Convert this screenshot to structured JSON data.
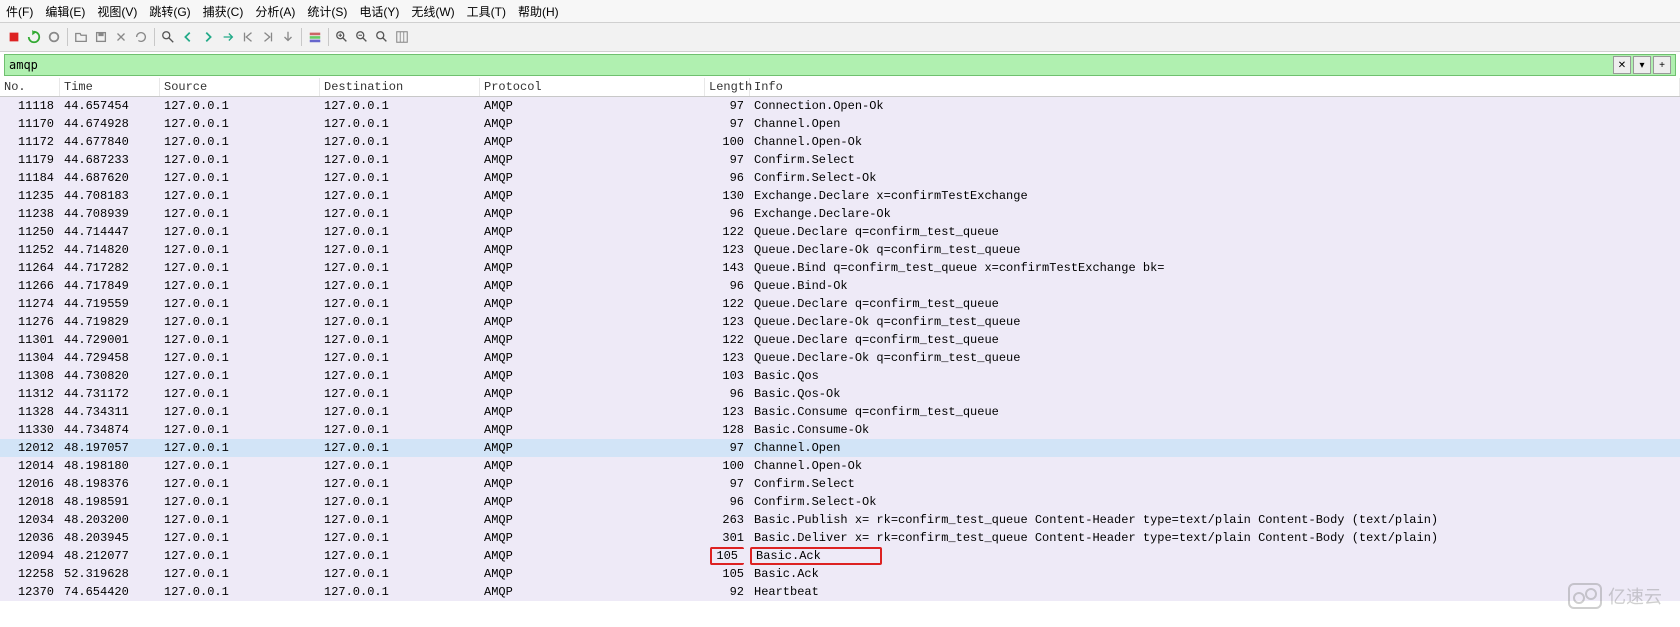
{
  "menu": {
    "items": [
      "件(F)",
      "编辑(E)",
      "视图(V)",
      "跳转(G)",
      "捕获(C)",
      "分析(A)",
      "统计(S)",
      "电话(Y)",
      "无线(W)",
      "工具(T)",
      "帮助(H)"
    ]
  },
  "filter": {
    "text": "amqp",
    "buttons": [
      "✕",
      "▾",
      "+"
    ]
  },
  "columns": [
    "No.",
    "Time",
    "Source",
    "Destination",
    "Protocol",
    "Length",
    "Info"
  ],
  "packets": [
    {
      "no": "11118",
      "time": "44.657454",
      "src": "127.0.0.1",
      "dst": "127.0.0.1",
      "proto": "AMQP",
      "len": "97",
      "info": "Connection.Open-Ok"
    },
    {
      "no": "11170",
      "time": "44.674928",
      "src": "127.0.0.1",
      "dst": "127.0.0.1",
      "proto": "AMQP",
      "len": "97",
      "info": "Channel.Open"
    },
    {
      "no": "11172",
      "time": "44.677840",
      "src": "127.0.0.1",
      "dst": "127.0.0.1",
      "proto": "AMQP",
      "len": "100",
      "info": "Channel.Open-Ok"
    },
    {
      "no": "11179",
      "time": "44.687233",
      "src": "127.0.0.1",
      "dst": "127.0.0.1",
      "proto": "AMQP",
      "len": "97",
      "info": "Confirm.Select"
    },
    {
      "no": "11184",
      "time": "44.687620",
      "src": "127.0.0.1",
      "dst": "127.0.0.1",
      "proto": "AMQP",
      "len": "96",
      "info": "Confirm.Select-Ok"
    },
    {
      "no": "11235",
      "time": "44.708183",
      "src": "127.0.0.1",
      "dst": "127.0.0.1",
      "proto": "AMQP",
      "len": "130",
      "info": "Exchange.Declare x=confirmTestExchange"
    },
    {
      "no": "11238",
      "time": "44.708939",
      "src": "127.0.0.1",
      "dst": "127.0.0.1",
      "proto": "AMQP",
      "len": "96",
      "info": "Exchange.Declare-Ok"
    },
    {
      "no": "11250",
      "time": "44.714447",
      "src": "127.0.0.1",
      "dst": "127.0.0.1",
      "proto": "AMQP",
      "len": "122",
      "info": "Queue.Declare q=confirm_test_queue"
    },
    {
      "no": "11252",
      "time": "44.714820",
      "src": "127.0.0.1",
      "dst": "127.0.0.1",
      "proto": "AMQP",
      "len": "123",
      "info": "Queue.Declare-Ok q=confirm_test_queue"
    },
    {
      "no": "11264",
      "time": "44.717282",
      "src": "127.0.0.1",
      "dst": "127.0.0.1",
      "proto": "AMQP",
      "len": "143",
      "info": "Queue.Bind q=confirm_test_queue x=confirmTestExchange bk="
    },
    {
      "no": "11266",
      "time": "44.717849",
      "src": "127.0.0.1",
      "dst": "127.0.0.1",
      "proto": "AMQP",
      "len": "96",
      "info": "Queue.Bind-Ok"
    },
    {
      "no": "11274",
      "time": "44.719559",
      "src": "127.0.0.1",
      "dst": "127.0.0.1",
      "proto": "AMQP",
      "len": "122",
      "info": "Queue.Declare q=confirm_test_queue"
    },
    {
      "no": "11276",
      "time": "44.719829",
      "src": "127.0.0.1",
      "dst": "127.0.0.1",
      "proto": "AMQP",
      "len": "123",
      "info": "Queue.Declare-Ok q=confirm_test_queue"
    },
    {
      "no": "11301",
      "time": "44.729001",
      "src": "127.0.0.1",
      "dst": "127.0.0.1",
      "proto": "AMQP",
      "len": "122",
      "info": "Queue.Declare q=confirm_test_queue"
    },
    {
      "no": "11304",
      "time": "44.729458",
      "src": "127.0.0.1",
      "dst": "127.0.0.1",
      "proto": "AMQP",
      "len": "123",
      "info": "Queue.Declare-Ok q=confirm_test_queue"
    },
    {
      "no": "11308",
      "time": "44.730820",
      "src": "127.0.0.1",
      "dst": "127.0.0.1",
      "proto": "AMQP",
      "len": "103",
      "info": "Basic.Qos"
    },
    {
      "no": "11312",
      "time": "44.731172",
      "src": "127.0.0.1",
      "dst": "127.0.0.1",
      "proto": "AMQP",
      "len": "96",
      "info": "Basic.Qos-Ok"
    },
    {
      "no": "11328",
      "time": "44.734311",
      "src": "127.0.0.1",
      "dst": "127.0.0.1",
      "proto": "AMQP",
      "len": "123",
      "info": "Basic.Consume q=confirm_test_queue"
    },
    {
      "no": "11330",
      "time": "44.734874",
      "src": "127.0.0.1",
      "dst": "127.0.0.1",
      "proto": "AMQP",
      "len": "128",
      "info": "Basic.Consume-Ok"
    },
    {
      "no": "12012",
      "time": "48.197057",
      "src": "127.0.0.1",
      "dst": "127.0.0.1",
      "proto": "AMQP",
      "len": "97",
      "info": "Channel.Open",
      "selected": true
    },
    {
      "no": "12014",
      "time": "48.198180",
      "src": "127.0.0.1",
      "dst": "127.0.0.1",
      "proto": "AMQP",
      "len": "100",
      "info": "Channel.Open-Ok"
    },
    {
      "no": "12016",
      "time": "48.198376",
      "src": "127.0.0.1",
      "dst": "127.0.0.1",
      "proto": "AMQP",
      "len": "97",
      "info": "Confirm.Select"
    },
    {
      "no": "12018",
      "time": "48.198591",
      "src": "127.0.0.1",
      "dst": "127.0.0.1",
      "proto": "AMQP",
      "len": "96",
      "info": "Confirm.Select-Ok"
    },
    {
      "no": "12034",
      "time": "48.203200",
      "src": "127.0.0.1",
      "dst": "127.0.0.1",
      "proto": "AMQP",
      "len": "263",
      "info": "Basic.Publish x= rk=confirm_test_queue Content-Header type=text/plain Content-Body  (text/plain)"
    },
    {
      "no": "12036",
      "time": "48.203945",
      "src": "127.0.0.1",
      "dst": "127.0.0.1",
      "proto": "AMQP",
      "len": "301",
      "info": "Basic.Deliver x= rk=confirm_test_queue Content-Header type=text/plain Content-Body  (text/plain)"
    },
    {
      "no": "12094",
      "time": "48.212077",
      "src": "127.0.0.1",
      "dst": "127.0.0.1",
      "proto": "AMQP",
      "len": "105",
      "info": "Basic.Ack",
      "highlight": true
    },
    {
      "no": "12258",
      "time": "52.319628",
      "src": "127.0.0.1",
      "dst": "127.0.0.1",
      "proto": "AMQP",
      "len": "105",
      "info": "Basic.Ack"
    },
    {
      "no": "12370",
      "time": "74.654420",
      "src": "127.0.0.1",
      "dst": "127.0.0.1",
      "proto": "AMQP",
      "len": "92",
      "info": "Heartbeat"
    }
  ],
  "watermark": "亿速云"
}
